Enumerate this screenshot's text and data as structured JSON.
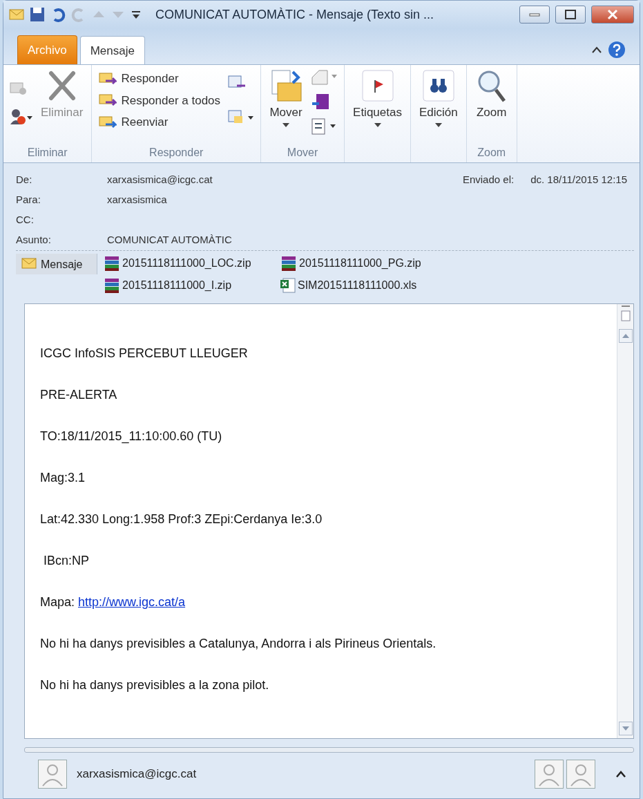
{
  "window": {
    "title": "COMUNICAT AUTOMÀTIC  -  Mensaje (Texto sin ..."
  },
  "tabs": [
    {
      "label": "Archivo",
      "kind": "file",
      "selected": false
    },
    {
      "label": "Mensaje",
      "kind": "tab",
      "selected": true
    }
  ],
  "ribbon": {
    "groups": [
      {
        "label": "Eliminar",
        "buttons": [
          {
            "label": "Eliminar",
            "kind": "delete",
            "disabled": true
          }
        ]
      },
      {
        "label": "Responder",
        "buttons": [
          {
            "label": "Responder",
            "kind": "reply",
            "disabled": false
          },
          {
            "label": "Responder a todos",
            "kind": "reply-all",
            "disabled": false
          },
          {
            "label": "Reenviar",
            "kind": "forward",
            "disabled": false
          }
        ]
      },
      {
        "label": "Mover",
        "buttons": [
          {
            "label": "Mover",
            "kind": "move",
            "disabled": false
          }
        ]
      },
      {
        "buttons": [
          {
            "label": "Etiquetas",
            "kind": "tags",
            "disabled": false
          }
        ]
      },
      {
        "buttons": [
          {
            "label": "Edición",
            "kind": "edit",
            "disabled": false
          }
        ]
      },
      {
        "label": "Zoom",
        "buttons": [
          {
            "label": "Zoom",
            "kind": "zoom",
            "disabled": false
          }
        ]
      }
    ]
  },
  "header": {
    "fields": [
      {
        "label": "De:",
        "value": "xarxasismica@icgc.cat"
      },
      {
        "label": "Para:",
        "value": "xarxasismica"
      },
      {
        "label": "CC:"
      },
      {
        "label": "Asunto:",
        "value": "COMUNICAT AUTOMÀTIC"
      }
    ],
    "sent": {
      "label": "Enviado el:",
      "value": "dc. 18/11/2015 12:15"
    }
  },
  "attachments": {
    "message": {
      "label": "Mensaje",
      "selected": true
    },
    "files": [
      {
        "name": "20151118111000_LOC.zip",
        "kind": "zip"
      },
      {
        "name": "20151118111000_PG.zip",
        "kind": "zip"
      },
      {
        "name": "20151118111000_I.zip",
        "kind": "zip"
      },
      {
        "name": "SIM20151118111000.xls",
        "kind": "xls"
      }
    ]
  },
  "body": [
    {
      "text": "ICGC InfoSIS PERCEBUT LLEUGER"
    },
    {
      "text": "PRE-ALERTA"
    },
    {
      "text": "TO:18/11/2015_11:10:00.60 (TU)"
    },
    {
      "text": "Mag:3.1"
    },
    {
      "text": "Lat:42.330 Long:1.958 Prof:3 ZEpi:Cerdanya Ie:3.0"
    },
    {
      "text": " IBcn:NP"
    },
    {
      "text": "Mapa: ",
      "link": "http://www.igc.cat/a"
    },
    {
      "text": "No hi ha danys previsibles a Catalunya, Andorra i als Pirineus Orientals."
    },
    {
      "text": "No hi ha danys previsibles a la zona pilot."
    }
  ],
  "people": {
    "sender": "xarxasismica@icgc.cat"
  }
}
